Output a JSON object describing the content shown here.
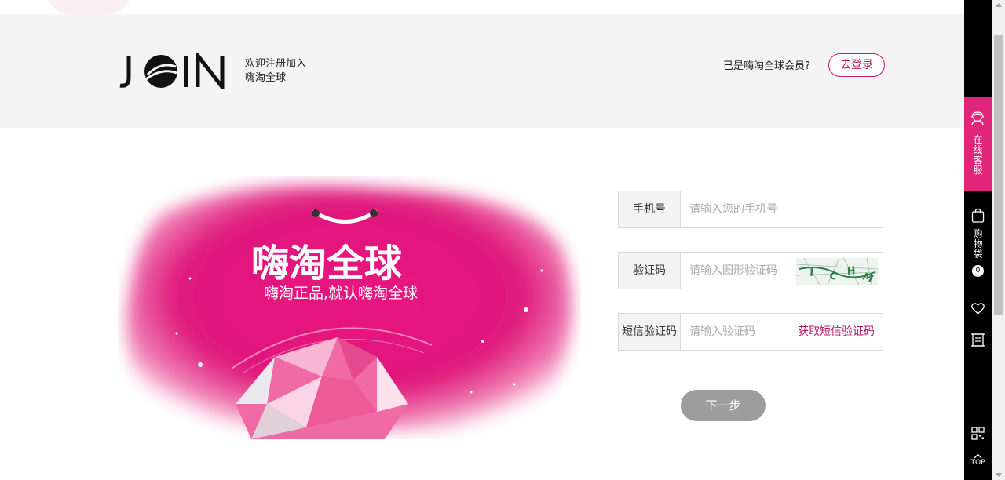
{
  "header": {
    "logo_text": "JOIN",
    "tagline_line1": "欢迎注册加入",
    "tagline_line2": "嗨淘全球",
    "member_prompt": "已是嗨淘全球会员?",
    "login_button": "去登录"
  },
  "banner": {
    "brand": "嗨淘全球",
    "slogan": "嗨淘正品,就认嗨淘全球"
  },
  "form": {
    "phone": {
      "label": "手机号",
      "placeholder": "请输入您的手机号",
      "value": ""
    },
    "captcha": {
      "label": "验证码",
      "placeholder": "请输入图形验证码",
      "value": ""
    },
    "sms": {
      "label": "短信验证码",
      "placeholder": "请输入验证码",
      "value": "",
      "action": "获取短信验证码"
    },
    "next_button": "下一步"
  },
  "sidebar": {
    "service_label": "在线客服",
    "cart_label": "购物袋",
    "cart_count": "0",
    "top_label": "TOP",
    "icons": [
      "service-icon",
      "bag-icon",
      "heart-icon",
      "list-icon",
      "qr-code-icon",
      "arrow-up-icon"
    ]
  },
  "colors": {
    "accent": "#e0257a",
    "link": "#b5176a",
    "header_bg": "#f4f4f4",
    "button_disabled": "#9d9d9d"
  }
}
